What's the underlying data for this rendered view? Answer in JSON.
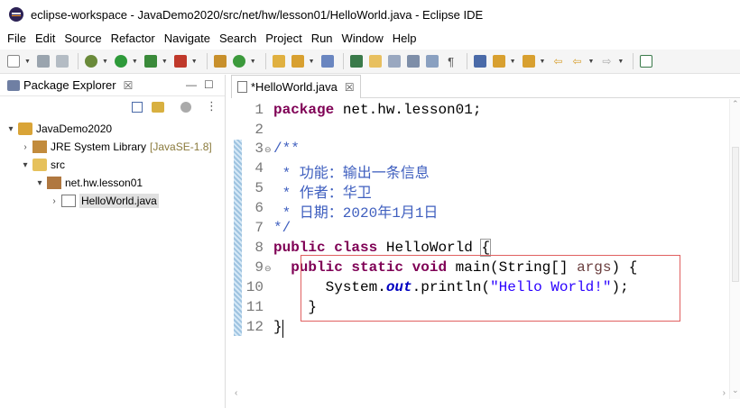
{
  "window": {
    "title": "eclipse-workspace - JavaDemo2020/src/net/hw/lesson01/HelloWorld.java - Eclipse IDE"
  },
  "menu": {
    "items": [
      {
        "label": "File"
      },
      {
        "label": "Edit"
      },
      {
        "label": "Source"
      },
      {
        "label": "Refactor"
      },
      {
        "label": "Navigate"
      },
      {
        "label": "Search"
      },
      {
        "label": "Project"
      },
      {
        "label": "Run"
      },
      {
        "label": "Window"
      },
      {
        "label": "Help"
      }
    ]
  },
  "toolbar": {
    "icons": [
      "new-icon",
      "save-icon",
      "save-all-icon",
      "debug-icon",
      "run-icon",
      "run-coverage-icon",
      "external-tools-icon",
      "new-java-package-icon",
      "new-java-class-icon",
      "open-type-icon",
      "search-icon",
      "open-task-icon",
      "toggle-mark-occurrences-icon",
      "toggle-highlight-icon",
      "show-whitespace-icon",
      "toggle-breadcrumb-icon",
      "next-annotation-icon",
      "previous-annotation-icon",
      "last-edit-icon",
      "back-icon",
      "forward-icon",
      "open-perspective-icon"
    ]
  },
  "package_explorer": {
    "title": "Package Explorer",
    "close": "☒",
    "tree": [
      {
        "label": "JavaDemo2020",
        "level": 0,
        "arrow": "▾",
        "icon": "java-project-icon"
      },
      {
        "label": "JRE System Library",
        "decor": "[JavaSE-1.8]",
        "level": 1,
        "arrow": "›",
        "icon": "library-icon"
      },
      {
        "label": "src",
        "level": 1,
        "arrow": "▾",
        "icon": "source-folder-icon"
      },
      {
        "label": "net.hw.lesson01",
        "level": 2,
        "arrow": "▾",
        "icon": "package-icon"
      },
      {
        "label": "HelloWorld.java",
        "level": 3,
        "arrow": "›",
        "icon": "java-file-icon",
        "selected": true
      }
    ]
  },
  "editor": {
    "tab_label": "*HelloWorld.java",
    "tab_close": "☒",
    "line_numbers": [
      "1",
      "2",
      "3",
      "4",
      "5",
      "6",
      "7",
      "8",
      "9",
      "10",
      "11",
      "12"
    ],
    "lines": {
      "l1_kw": "package",
      "l1_rest": " net.hw.lesson01;",
      "l3": "/**",
      "l4": " * 功能：输出一条信息",
      "l5": " * 作者：华卫",
      "l6": " * 日期：2020年1月1日",
      "l7": "*/",
      "l8_kw1": "public",
      "l8_kw2": "class",
      "l8_rest": " HelloWorld ",
      "l8_brace": "{",
      "l9_indent": "  ",
      "l9_kw1": "public",
      "l9_kw2": "static",
      "l9_kw3": "void",
      "l9_rest1": " main(String[] ",
      "l9_param": "args",
      "l9_rest2": ") {",
      "l10_a": "      System.",
      "l10_field": "out",
      "l10_b": ".println(",
      "l10_str": "\"Hello World!\"",
      "l10_c": ");",
      "l11": "    }",
      "l12": "}"
    }
  },
  "colors": {
    "keyword": "#7f0055",
    "comment": "#3f5fbf",
    "string": "#2a00ff",
    "static_field": "#0000c0",
    "annotation_box": "#e06060"
  }
}
